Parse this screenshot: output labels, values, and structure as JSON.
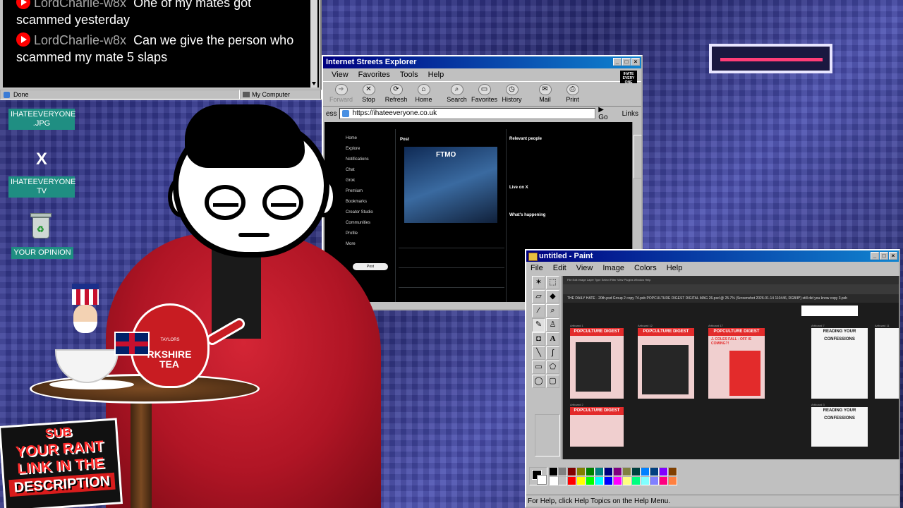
{
  "chat": {
    "messages": [
      {
        "user": "LordCharlie-w8x",
        "text": "One of my mates got scammed yesterday"
      },
      {
        "user": "LordCharlie-w8x",
        "text": "Can we give the person who scammed my mate 5 slaps"
      }
    ],
    "status_left": "Done",
    "status_right": "My Computer"
  },
  "desktop": {
    "icons": [
      {
        "label": "IHATEEVERYONE .JPG",
        "icon": "image-icon"
      },
      {
        "label": "IHATEEVERYONE TV",
        "icon": "x-logo-icon"
      },
      {
        "label": "YOUR OPINION",
        "icon": "recycle-bin-icon"
      }
    ],
    "x_glyph": "X"
  },
  "browser": {
    "title": "Internet Streets Explorer",
    "menu": [
      "View",
      "Favorites",
      "Tools",
      "Help"
    ],
    "logo_text": "IHATE EVERY ONE",
    "toolbar": [
      "Forward",
      "Stop",
      "Refresh",
      "Home",
      "Search",
      "Favorites",
      "History",
      "Mail",
      "Print"
    ],
    "address_label": "ess",
    "address": "https://ihateeveryone.co.uk",
    "go": "Go",
    "links": "Links",
    "x_page": {
      "nav": [
        "Home",
        "Explore",
        "Notifications",
        "Chat",
        "Grok",
        "Premium",
        "Bookmarks",
        "Creator Studio",
        "Communities",
        "Profile",
        "More"
      ],
      "post_button": "Post",
      "header": "Post",
      "video_brand": "FTMO",
      "sidebar_title": "Relevant people",
      "live_title": "Live on X",
      "happening_title": "What's happening"
    }
  },
  "paint": {
    "title": "untitled - Paint",
    "menu": [
      "File",
      "Edit",
      "View",
      "Image",
      "Colors",
      "Help"
    ],
    "status": "For Help, click Help Topics on the Help Menu.",
    "photoshop": {
      "menubar": "File  Edit  Image  Layer  Type  Select  Filter  View  Plugins  Window  Help",
      "tabs": "THE DAILY HATE · 20th.psd      Group 2 copy 74.psb      POPCULTURE DIGEST DIGITAL MAG 26.psd @ 25.7% (Screenshot 2026-01-14 110446, RGB/8*)      still did you know copy 3.psb",
      "artboard_heading": "POPCULTURE DIGEST",
      "artboard_sub": "J. COLES FALL - OFF IS COMING?!",
      "reading_heading": "READING YOUR CONFESSIONS",
      "artboard_labels": [
        "Artboard 1",
        "Artboard 12",
        "Artboard 17",
        "Artboard 7",
        "Artboard 11",
        "Artboard 2",
        "Artboard 3"
      ]
    },
    "palette": [
      "#000000",
      "#808080",
      "#800000",
      "#808000",
      "#008000",
      "#008080",
      "#000080",
      "#800080",
      "#808040",
      "#004040",
      "#0080ff",
      "#004080",
      "#8000ff",
      "#804000",
      "#ffffff",
      "#c0c0c0",
      "#ff0000",
      "#ffff00",
      "#00ff00",
      "#00ffff",
      "#0000ff",
      "#ff00ff",
      "#ffff80",
      "#00ff80",
      "#80ffff",
      "#8080ff",
      "#ff0080",
      "#ff8040"
    ]
  },
  "stream_overlay": {
    "teapot_label": "RKSHIRE TEA",
    "teapot_brand": "TAYLORS",
    "promo": [
      "SUB",
      "YOUR RANT",
      "LINK IN THE",
      "DESCRIPTION"
    ]
  }
}
